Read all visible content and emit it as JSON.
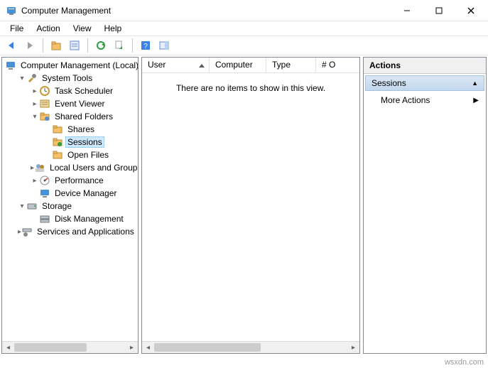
{
  "window": {
    "title": "Computer Management"
  },
  "menu": {
    "file": "File",
    "action": "Action",
    "view": "View",
    "help": "Help"
  },
  "tree": {
    "root": "Computer Management (Local)",
    "system_tools": "System Tools",
    "task_scheduler": "Task Scheduler",
    "event_viewer": "Event Viewer",
    "shared_folders": "Shared Folders",
    "shares": "Shares",
    "sessions": "Sessions",
    "open_files": "Open Files",
    "local_users": "Local Users and Groups",
    "performance": "Performance",
    "device_manager": "Device Manager",
    "storage": "Storage",
    "disk_management": "Disk Management",
    "services_apps": "Services and Applications"
  },
  "list": {
    "columns": {
      "user": "User",
      "computer": "Computer",
      "type": "Type",
      "open": "# O"
    },
    "empty_message": "There are no items to show in this view."
  },
  "actions": {
    "header": "Actions",
    "context": "Sessions",
    "more": "More Actions"
  },
  "watermark": "wsxdn.com"
}
